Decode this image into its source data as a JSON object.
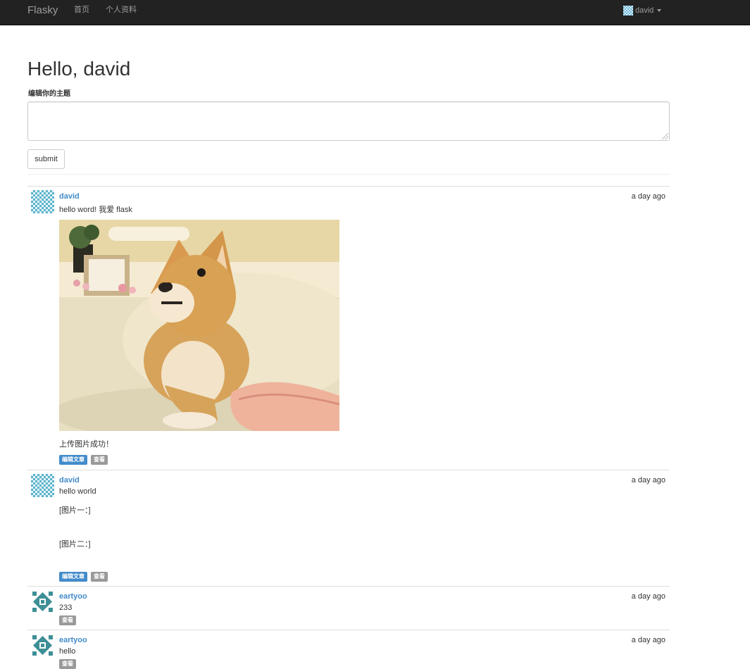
{
  "navbar": {
    "brand": "Flasky",
    "links": [
      "首页",
      "个人资料"
    ],
    "user": "david"
  },
  "main": {
    "greeting": "Hello, david",
    "form_label": "编辑你的主题",
    "submit_label": "submit"
  },
  "posts": [
    {
      "author": "david",
      "date": "a day ago",
      "lines": [
        "hello word! 我爱 flask",
        "上传图片成功！"
      ],
      "buttons": [
        "编辑文章",
        "查看"
      ]
    },
    {
      "author": "david",
      "date": "a day ago",
      "lines": [
        "hello world",
        "[图片一：]",
        "[图片二：]"
      ],
      "buttons": [
        "编辑文章",
        "查看"
      ]
    },
    {
      "author": "eartyoo",
      "date": "a day ago",
      "lines": [
        "233"
      ],
      "buttons": [
        "查看"
      ]
    },
    {
      "author": "eartyoo",
      "date": "a day ago",
      "lines": [
        "hello"
      ],
      "buttons": [
        "查看"
      ]
    }
  ],
  "colors": {
    "navbar": "#222222",
    "link": "#428bca",
    "label_primary": "#428bca",
    "label_default": "#999999",
    "identicon_david": "#5ab3cc",
    "identicon_eartyoo": "#3e8f96"
  }
}
